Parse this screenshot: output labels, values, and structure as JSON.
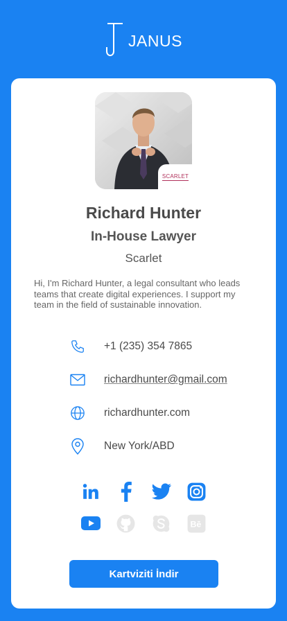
{
  "brand": {
    "name": "JANUS"
  },
  "profile": {
    "name": "Richard Hunter",
    "title": "In-House Lawyer",
    "company": "Scarlet",
    "company_badge": "SCARLET",
    "bio": "Hi, I'm Richard Hunter, a legal consultant who leads teams that create digital experiences. I support my team in the field of sustainable innovation."
  },
  "contact": {
    "phone": "+1 (235) 354 7865",
    "email": "richardhunter@gmail.com",
    "website": "richardhunter.com",
    "location": "New York/ABD"
  },
  "social": [
    {
      "name": "linkedin-icon",
      "active": true
    },
    {
      "name": "facebook-icon",
      "active": true
    },
    {
      "name": "twitter-icon",
      "active": true
    },
    {
      "name": "instagram-icon",
      "active": true
    },
    {
      "name": "youtube-icon",
      "active": true
    },
    {
      "name": "github-icon",
      "active": false
    },
    {
      "name": "skype-icon",
      "active": false
    },
    {
      "name": "behance-icon",
      "active": false
    }
  ],
  "actions": {
    "download_label": "Kartviziti İndir"
  },
  "colors": {
    "primary": "#1a82f2",
    "inactive_icon": "#e6e6e6",
    "text_dark": "#4a4a4a",
    "badge": "#b0305a"
  }
}
